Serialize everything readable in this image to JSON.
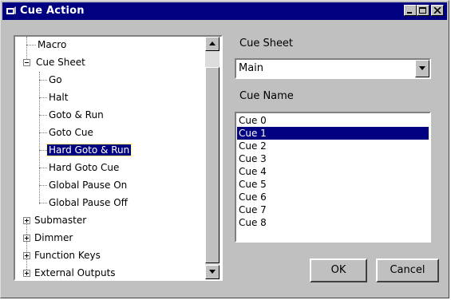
{
  "window": {
    "title": "Cue Action",
    "title_icon": "app-icon"
  },
  "titlebar_buttons": [
    "minimize",
    "maximize",
    "close"
  ],
  "tree": {
    "items": [
      {
        "label": "Macro",
        "level": 0,
        "expander": "none"
      },
      {
        "label": "Cue Sheet",
        "level": 0,
        "expander": "minus"
      },
      {
        "label": "Go",
        "level": 1
      },
      {
        "label": "Halt",
        "level": 1
      },
      {
        "label": "Goto & Run",
        "level": 1
      },
      {
        "label": "Goto Cue",
        "level": 1
      },
      {
        "label": "Hard Goto & Run",
        "level": 1,
        "selected": true
      },
      {
        "label": "Hard Goto Cue",
        "level": 1
      },
      {
        "label": "Global Pause On",
        "level": 1
      },
      {
        "label": "Global Pause Off",
        "level": 1
      },
      {
        "label": "Submaster",
        "level": 0,
        "expander": "plus"
      },
      {
        "label": "Dimmer",
        "level": 0,
        "expander": "plus"
      },
      {
        "label": "Function Keys",
        "level": 0,
        "expander": "plus"
      },
      {
        "label": "External Outputs",
        "level": 0,
        "expander": "plus"
      }
    ]
  },
  "cue_sheet": {
    "label": "Cue Sheet",
    "value": "Main"
  },
  "cue_name": {
    "label": "Cue Name",
    "items": [
      "Cue 0",
      "Cue 1",
      "Cue 2",
      "Cue 3",
      "Cue 4",
      "Cue 5",
      "Cue 6",
      "Cue 7",
      "Cue 8"
    ],
    "selected": "Cue 1"
  },
  "buttons": {
    "ok": "OK",
    "cancel": "Cancel"
  },
  "colors": {
    "face": "#c0c0c0",
    "titlebar": "#000080",
    "selection": "#000080"
  }
}
